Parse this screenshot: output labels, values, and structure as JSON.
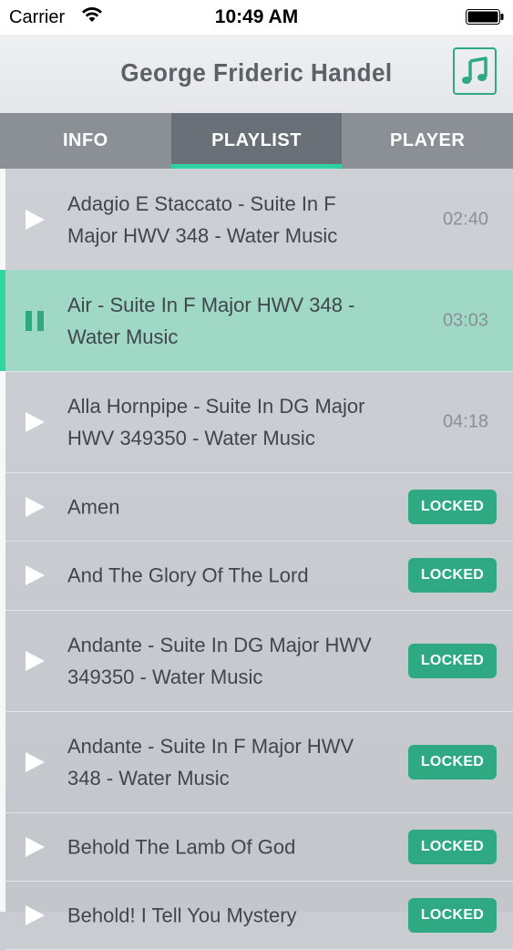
{
  "status": {
    "carrier": "Carrier",
    "time": "10:49 AM"
  },
  "header": {
    "title": "George Frideric Handel",
    "music_icon": "music-note-icon"
  },
  "tabs": [
    {
      "label": "INFO",
      "active": false
    },
    {
      "label": "PLAYLIST",
      "active": true
    },
    {
      "label": "PLAYER",
      "active": false
    }
  ],
  "playlist": [
    {
      "title": "Adagio E Staccato - Suite In F Major HWV 348 - Water Music",
      "duration": "02:40",
      "state": "play"
    },
    {
      "title": "Air - Suite In F Major HWV 348 - Water Music",
      "duration": "03:03",
      "state": "playing"
    },
    {
      "title": "Alla Hornpipe - Suite In DG Major HWV 349350 - Water Music",
      "duration": "04:18",
      "state": "play"
    },
    {
      "title": "Amen",
      "badge": "LOCKED",
      "state": "play"
    },
    {
      "title": "And The Glory Of The Lord",
      "badge": "LOCKED",
      "state": "play"
    },
    {
      "title": "Andante - Suite In DG Major HWV 349350 - Water Music",
      "badge": "LOCKED",
      "state": "play"
    },
    {
      "title": "Andante - Suite In F Major HWV 348 - Water Music",
      "badge": "LOCKED",
      "state": "play"
    },
    {
      "title": "Behold The Lamb Of God",
      "badge": "LOCKED",
      "state": "play"
    },
    {
      "title": "Behold! I Tell You Mystery",
      "badge": "LOCKED",
      "state": "play"
    }
  ],
  "colors": {
    "accent": "#2fa982",
    "active_row": "#9fd8c4",
    "tab_active_underline": "#2ed3a3"
  }
}
